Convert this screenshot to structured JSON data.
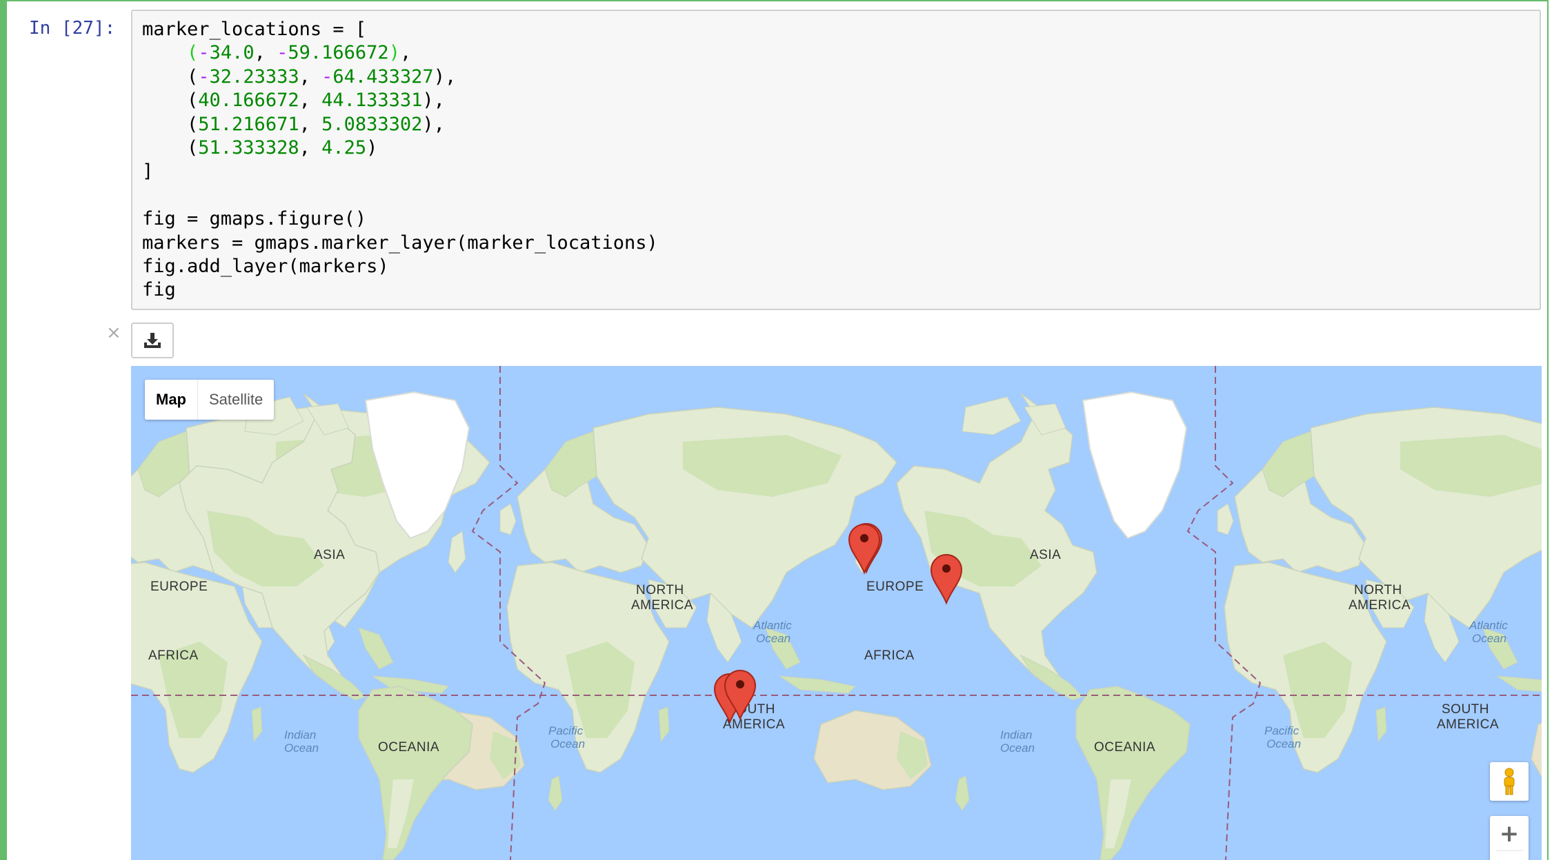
{
  "cell": {
    "prompt": "In [27]:",
    "code_lines": [
      [
        {
          "t": "marker_locations = [",
          "c": "default"
        }
      ],
      [
        {
          "t": "    ",
          "c": "default"
        },
        {
          "t": "(",
          "c": "paren-hl"
        },
        {
          "t": "-",
          "c": "op"
        },
        {
          "t": "34.0",
          "c": "num"
        },
        {
          "t": ", ",
          "c": "default"
        },
        {
          "t": "-",
          "c": "op"
        },
        {
          "t": "59.166672",
          "c": "num"
        },
        {
          "t": ")",
          "c": "paren-hl"
        },
        {
          "t": ",",
          "c": "default"
        }
      ],
      [
        {
          "t": "    (",
          "c": "default"
        },
        {
          "t": "-",
          "c": "op"
        },
        {
          "t": "32.23333",
          "c": "num"
        },
        {
          "t": ", ",
          "c": "default"
        },
        {
          "t": "-",
          "c": "op"
        },
        {
          "t": "64.433327",
          "c": "num"
        },
        {
          "t": "),",
          "c": "default"
        }
      ],
      [
        {
          "t": "    (",
          "c": "default"
        },
        {
          "t": "40.166672",
          "c": "num"
        },
        {
          "t": ", ",
          "c": "default"
        },
        {
          "t": "44.133331",
          "c": "num"
        },
        {
          "t": "),",
          "c": "default"
        }
      ],
      [
        {
          "t": "    (",
          "c": "default"
        },
        {
          "t": "51.216671",
          "c": "num"
        },
        {
          "t": ", ",
          "c": "default"
        },
        {
          "t": "5.0833302",
          "c": "num"
        },
        {
          "t": "),",
          "c": "default"
        }
      ],
      [
        {
          "t": "    (",
          "c": "default"
        },
        {
          "t": "51.333328",
          "c": "num"
        },
        {
          "t": ", ",
          "c": "default"
        },
        {
          "t": "4.25",
          "c": "num"
        },
        {
          "t": ")",
          "c": "default"
        }
      ],
      [
        {
          "t": "]",
          "c": "default"
        }
      ],
      [
        {
          "t": "",
          "c": "default"
        }
      ],
      [
        {
          "t": "fig = gmaps.figure()",
          "c": "default"
        }
      ],
      [
        {
          "t": "markers = gmaps.marker_layer(marker_locations)",
          "c": "default"
        }
      ],
      [
        {
          "t": "fig.add_layer(markers)",
          "c": "default"
        }
      ],
      [
        {
          "t": "fig",
          "c": "default"
        }
      ]
    ]
  },
  "output": {
    "close_glyph": "×",
    "download_icon": "download-icon"
  },
  "map": {
    "type_buttons": [
      {
        "label": "Map",
        "active": true
      },
      {
        "label": "Satellite",
        "active": false
      }
    ],
    "continent_labels": [
      "ASIA",
      "EUROPE",
      "AFRICA",
      "OCEANIA",
      "NORTH",
      "AMERICA",
      "EUROPE",
      "ASIA",
      "NORTH",
      "AMERICA",
      "AFRICA",
      "SOUTH",
      "AMERICA",
      "OCEANIA",
      "NORTH",
      "AMERICA",
      "SOUTH",
      "AMERICA"
    ],
    "ocean_labels": [
      "Indian",
      "Ocean",
      "Atlantic",
      "Ocean",
      "Pacific",
      "Ocean",
      "Indian",
      "Ocean",
      "Pacific",
      "Ocean",
      "Atlantic",
      "Ocean"
    ],
    "zoom_in": "+",
    "zoom_out": "−",
    "colors": {
      "water": "#a3ccff",
      "land": "#e8eedc",
      "land_green": "#cfe3b5",
      "ice": "#ffffff",
      "marker": "#e74c3c",
      "marker_dark": "#a8261a"
    }
  }
}
